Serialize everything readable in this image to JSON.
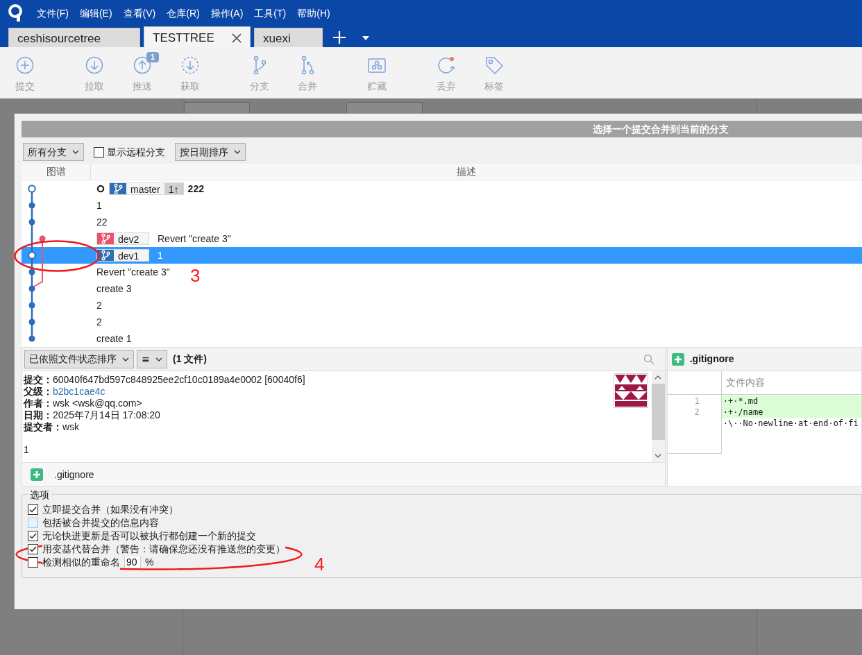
{
  "menu_bar": {
    "items": [
      "文件(F)",
      "编辑(E)",
      "查看(V)",
      "仓库(R)",
      "操作(A)",
      "工具(T)",
      "帮助(H)"
    ]
  },
  "repo_tabs": [
    {
      "label": "ceshisourcetree",
      "selected": false
    },
    {
      "label": "TESTTREE",
      "selected": true
    },
    {
      "label": "xuexi",
      "selected": false
    }
  ],
  "toolbar": {
    "groups": [
      [
        {
          "kind": "commit",
          "label": "提交"
        }
      ],
      [
        {
          "kind": "pull",
          "label": "拉取"
        },
        {
          "kind": "push",
          "label": "推送",
          "badge": "1"
        },
        {
          "kind": "fetch",
          "label": "获取"
        }
      ],
      [
        {
          "kind": "branch",
          "label": "分支"
        },
        {
          "kind": "merge",
          "label": "合并"
        }
      ],
      [
        {
          "kind": "stash",
          "label": "贮藏"
        }
      ],
      [
        {
          "kind": "discard",
          "label": "丢弃"
        },
        {
          "kind": "tag",
          "label": "标签"
        }
      ]
    ]
  },
  "dialog": {
    "title": "选择一个提交合并到当前的分支",
    "filters": {
      "branch_select": "所有分支",
      "show_remote": {
        "label": "显示远程分支",
        "checked": false
      },
      "sort_select": "按日期排序"
    },
    "columns": [
      "图谱",
      "描述"
    ],
    "commits": [
      {
        "kind": "hollow",
        "head": true,
        "selected": false,
        "refs": [
          {
            "name": "master",
            "color": "#2f6db5",
            "ahead": "1↑"
          }
        ],
        "message": "222"
      },
      {
        "kind": "dot",
        "head": false,
        "selected": false,
        "message": "1"
      },
      {
        "kind": "dot",
        "head": false,
        "selected": false,
        "message": "22"
      },
      {
        "kind": "sidedot",
        "head": false,
        "selected": false,
        "refs": [
          {
            "name": "dev2",
            "color": "#e8546b"
          }
        ],
        "message": "Revert \"create 3\""
      },
      {
        "kind": "hollow",
        "head": false,
        "selected": true,
        "refs": [
          {
            "name": "dev1",
            "color": "#2f6db5"
          }
        ],
        "message": "1"
      },
      {
        "kind": "dot",
        "head": false,
        "selected": false,
        "message": "Revert \"create 3\""
      },
      {
        "kind": "mergedot",
        "head": false,
        "selected": false,
        "message": "create 3"
      },
      {
        "kind": "dot",
        "head": false,
        "selected": false,
        "message": "2"
      },
      {
        "kind": "dot",
        "head": false,
        "selected": false,
        "message": "2"
      },
      {
        "kind": "dot",
        "head": false,
        "selected": false,
        "message": "create 1"
      }
    ],
    "file_sort_select": "已依照文件状态排序",
    "view_mode_select": "≣",
    "file_count": "(1 文件)",
    "details": [
      {
        "label": "提交：",
        "value": "60040f647bd597c848925ee2cf10c0189a4e0002 [60040f6]",
        "kind": "text"
      },
      {
        "label": "父级：",
        "value": "b2bc1cae4c",
        "kind": "link"
      },
      {
        "label": "作者：",
        "value": "wsk <wsk@qq.com>",
        "kind": "text"
      },
      {
        "label": "日期：",
        "value": "2025年7月14日 17:08:20",
        "kind": "text"
      },
      {
        "label": "提交者：",
        "value": "wsk",
        "kind": "text"
      }
    ],
    "message": "1",
    "files": [
      {
        "name": ".gitignore",
        "kind": "added"
      }
    ],
    "diff": {
      "file": ".gitignore",
      "kind": "added",
      "header": "文件内容",
      "lines": [
        {
          "number": "1",
          "text": "·+·*.md",
          "kind": "added"
        },
        {
          "number": "2",
          "text": "·+·/name",
          "kind": "added"
        },
        {
          "text": "·\\··No·newline·at·end·of·fi",
          "kind": "context"
        }
      ]
    },
    "options": {
      "legend": "选项",
      "items": [
        {
          "label": "立即提交合并（如果没有冲突）",
          "checked": true,
          "hovered": false
        },
        {
          "label": "包括被合并提交的信息内容",
          "checked": false,
          "hovered": true
        },
        {
          "label": "无论快进更新是否可以被执行都创建一个新的提交",
          "checked": true,
          "hovered": false
        },
        {
          "label": "用变基代替合并（警告：请确保您还没有推送您的变更）",
          "checked": true,
          "hovered": false
        },
        {
          "label": "检测相似的重命名",
          "checked": false,
          "hovered": false,
          "value": "90",
          "suffix": "%"
        }
      ]
    }
  },
  "annotations": [
    {
      "label": "3"
    },
    {
      "label": "4"
    }
  ]
}
